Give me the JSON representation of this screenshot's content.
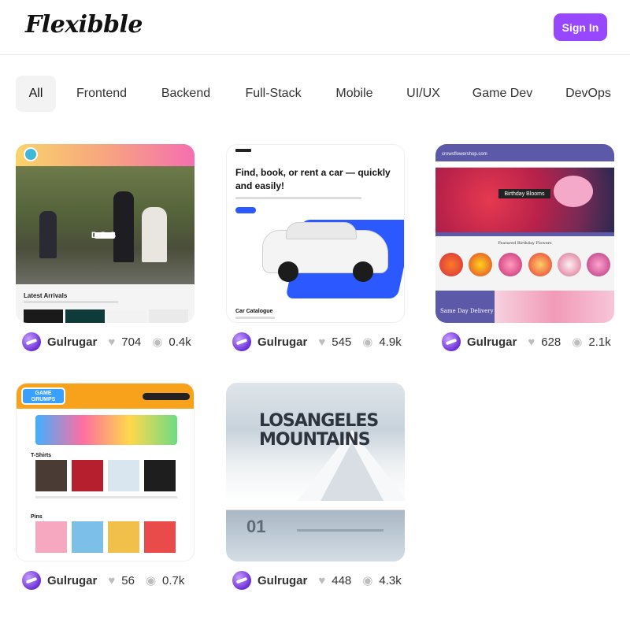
{
  "header": {
    "logo": "Flexibble",
    "signin_label": "Sign In"
  },
  "categories": [
    "All",
    "Frontend",
    "Backend",
    "Full-Stack",
    "Mobile",
    "UI/UX",
    "Game Dev",
    "DevOps"
  ],
  "projects": [
    {
      "author": "Gulrugar",
      "likes": "704",
      "views": "0.4k",
      "preview": {
        "hero_text": "DDS",
        "section_title": "Latest Arrivals"
      }
    },
    {
      "author": "Gulrugar",
      "likes": "545",
      "views": "4.9k",
      "preview": {
        "headline": "Find, book, or rent a car — quickly and easily!",
        "section_title": "Car Catalogue"
      }
    },
    {
      "author": "Gulrugar",
      "likes": "628",
      "views": "2.1k",
      "preview": {
        "site_name": "crowsflowershop.com",
        "banner": "Birthday Blooms",
        "section_title": "Featured Birthday Flowers",
        "promo": "Same Day Delivery"
      }
    },
    {
      "author": "Gulrugar",
      "likes": "56",
      "views": "0.7k",
      "preview": {
        "logo": "GAME GRUMPS",
        "section_a": "T-Shirts",
        "section_b": "Pins"
      }
    },
    {
      "author": "Gulrugar",
      "likes": "448",
      "views": "4.3k",
      "preview": {
        "title_line1": "LOSANGELES",
        "title_line2": "MOUNTAINS",
        "number": "01"
      }
    }
  ],
  "colors": {
    "accent": "#9747ff",
    "tab_active_bg": "#f3f3f4"
  },
  "icons": {
    "like": "heart-icon",
    "views": "eye-icon"
  }
}
